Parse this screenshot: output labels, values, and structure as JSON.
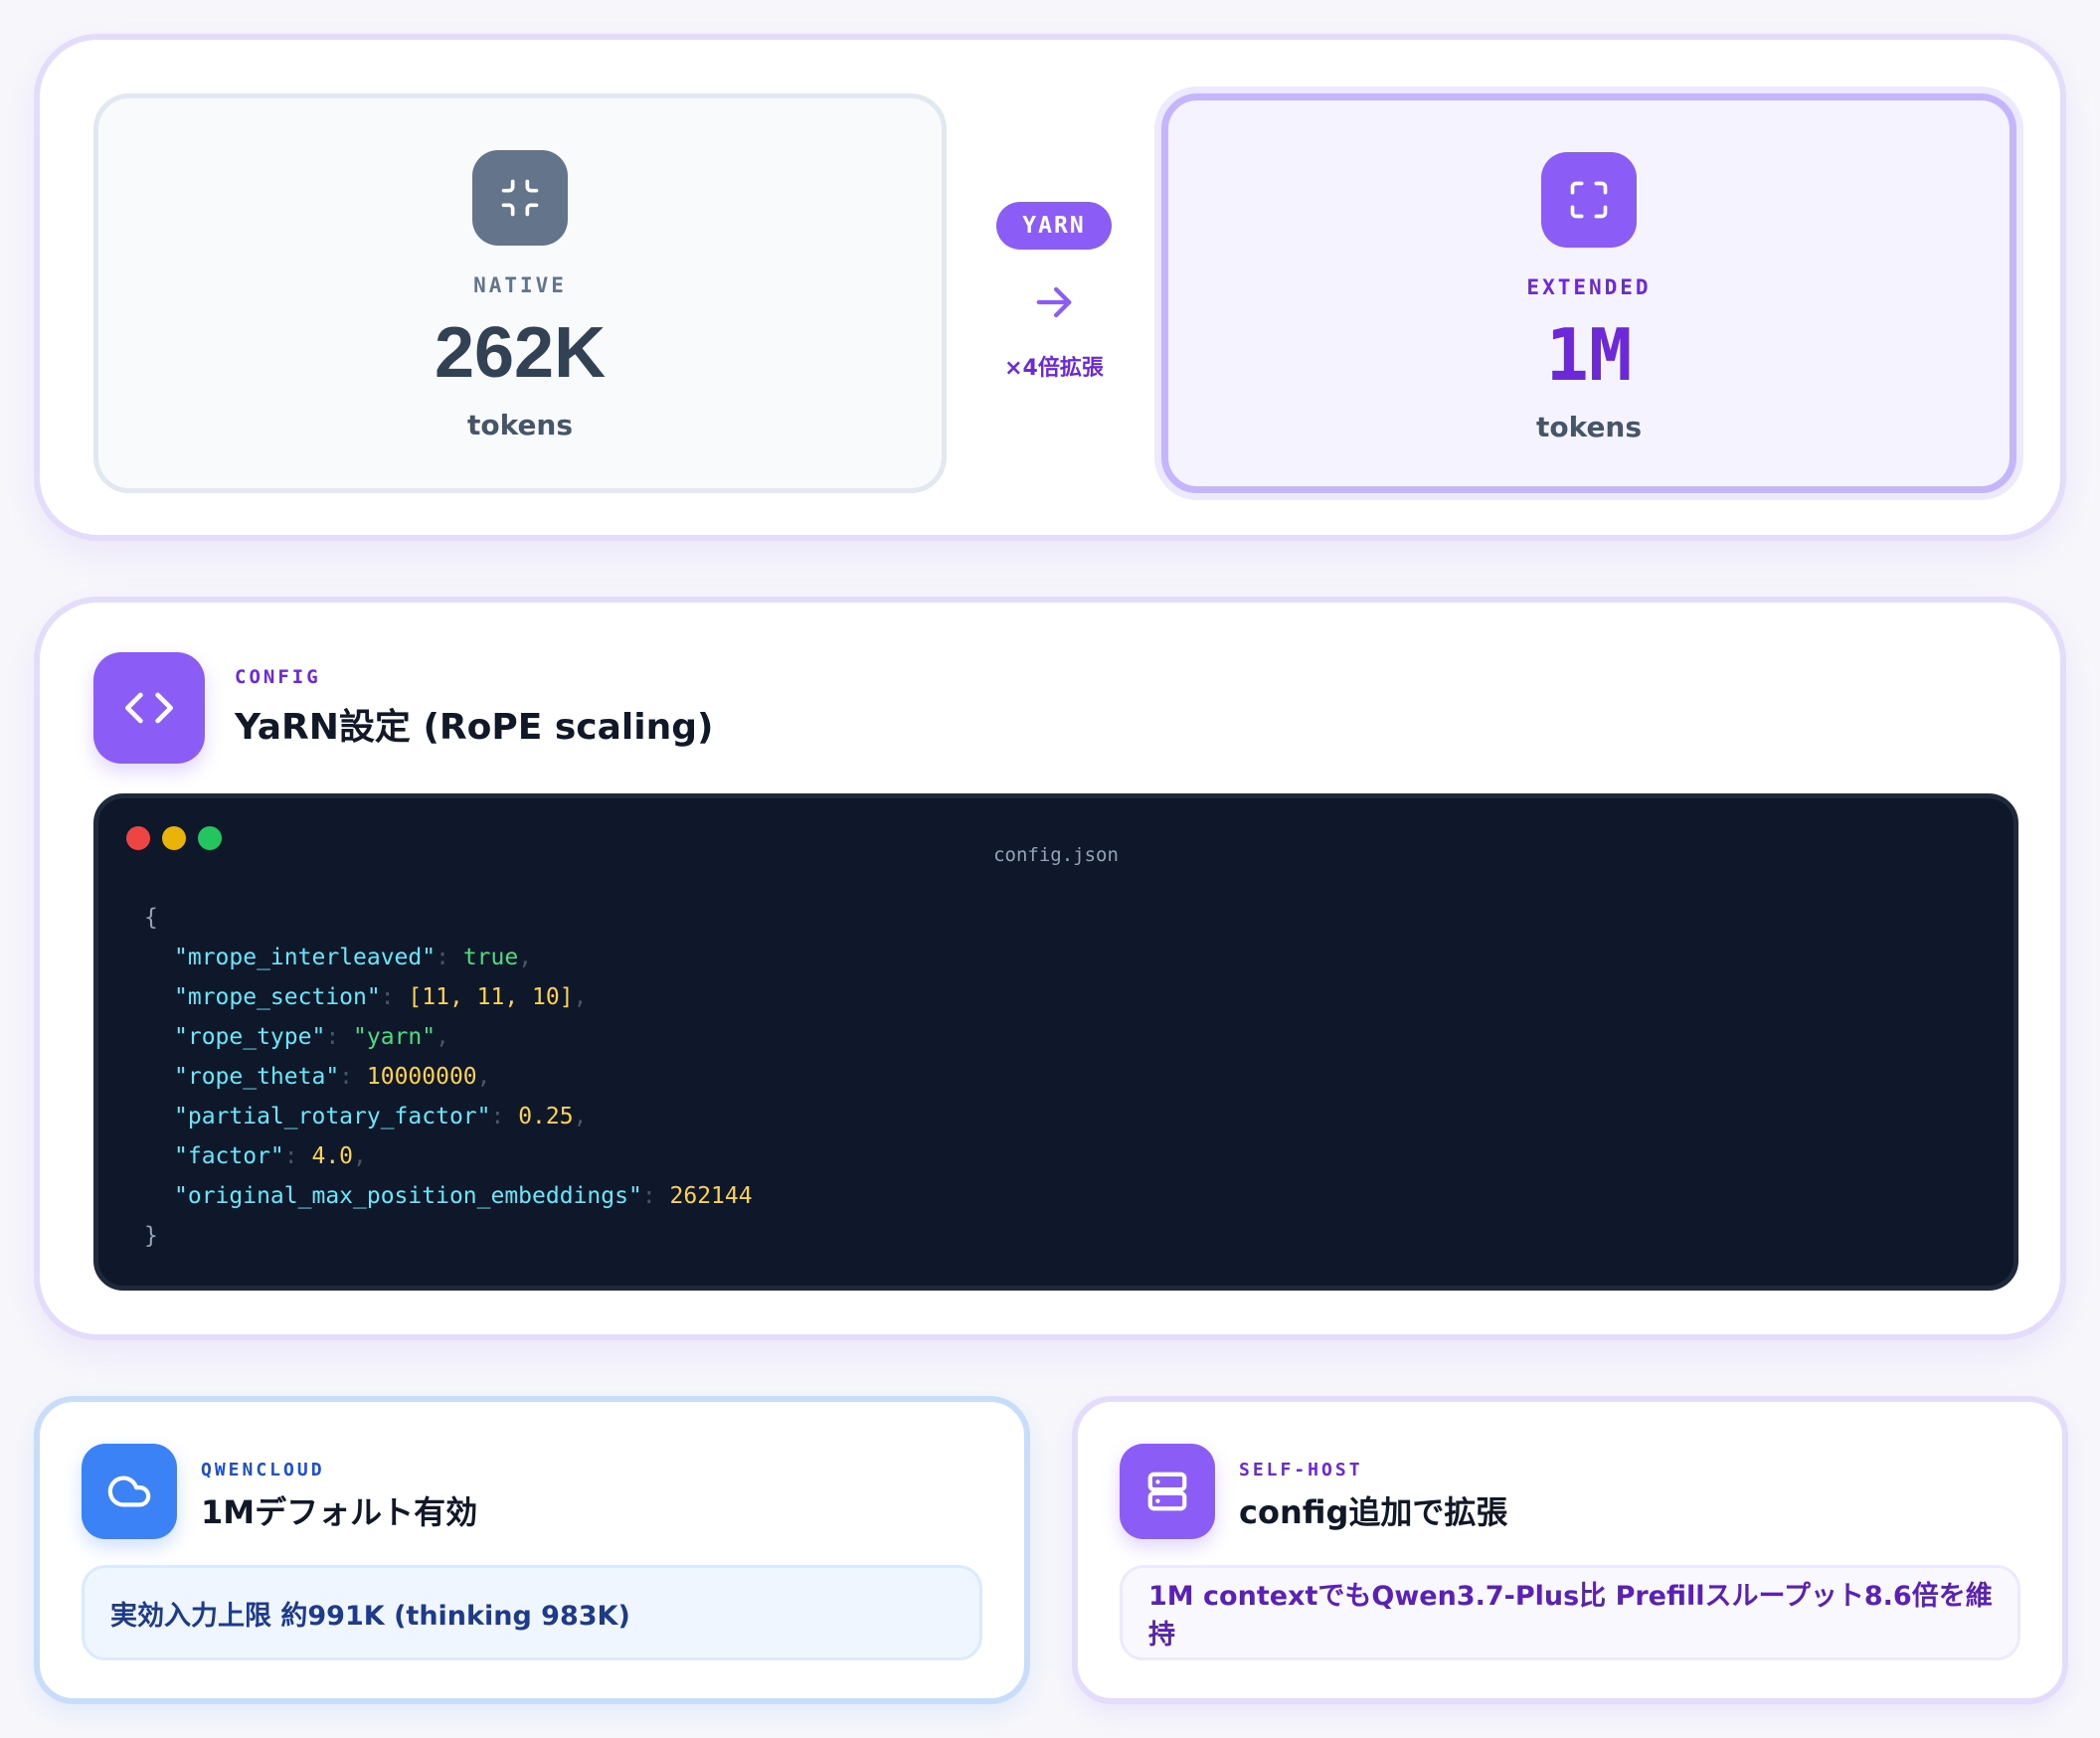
{
  "context": {
    "native": {
      "label": "NATIVE",
      "value": "262K",
      "unit": "tokens",
      "icon": "minimize-icon"
    },
    "extended": {
      "label": "EXTENDED",
      "value": "1M",
      "unit": "tokens",
      "icon": "maximize-icon"
    },
    "method_badge": "YARN",
    "factor_label": "×4倍拡張"
  },
  "config": {
    "eyebrow": "CONFIG",
    "title": "YaRN設定 (RoPE scaling)",
    "icon": "code-icon",
    "filename": "config.json",
    "open_brace": "{",
    "close_brace": "}",
    "lines": [
      {
        "key": "\"mrope_interleaved\"",
        "value": "true",
        "type": "bool"
      },
      {
        "key": "\"mrope_section\"",
        "value": "[11, 11, 10]",
        "type": "number"
      },
      {
        "key": "\"rope_type\"",
        "value": "\"yarn\"",
        "type": "string"
      },
      {
        "key": "\"rope_theta\"",
        "value": "10000000",
        "type": "number"
      },
      {
        "key": "\"partial_rotary_factor\"",
        "value": "0.25",
        "type": "number"
      },
      {
        "key": "\"factor\"",
        "value": "4.0",
        "type": "number"
      },
      {
        "key": "\"original_max_position_embeddings\"",
        "value": "262144",
        "type": "number"
      }
    ]
  },
  "cloud": {
    "eyebrow": "QWENCLOUD",
    "title": "1Mデフォルト有効",
    "note": "実効入力上限 約991K (thinking 983K)",
    "icon": "cloud-icon"
  },
  "selfhost": {
    "eyebrow": "SELF-HOST",
    "title": "config追加で拡張",
    "note": "1M contextでもQwen3.7-Plus比 Prefillスループット8.6倍を維持",
    "icon": "server-icon"
  },
  "colors": {
    "accent": "#8b5cf6",
    "accent_dark": "#6d28d9",
    "cloud_blue": "#3b82f6",
    "code_bg": "#0f172a"
  }
}
